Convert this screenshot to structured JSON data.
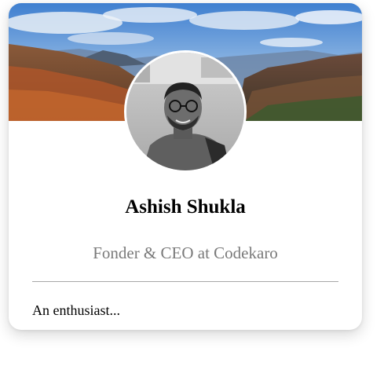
{
  "profile": {
    "name": "Ashish Shukla",
    "title": "Fonder & CEO at Codekaro",
    "bio": "An enthusiast..."
  },
  "colors": {
    "card_background": "#ffffff",
    "name_color": "#000000",
    "title_color": "#7a7a7a",
    "divider_color": "#a8a8a8"
  }
}
